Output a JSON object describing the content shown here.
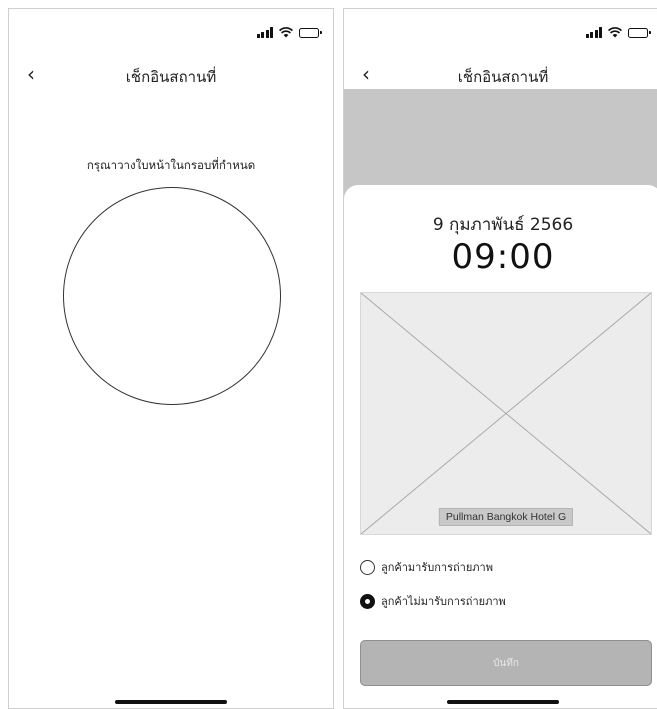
{
  "left_screen": {
    "nav": {
      "back_icon": "‹",
      "title": "เช็กอินสถานที่"
    },
    "instruction": "กรุณาวางใบหน้าในกรอบที่กำหนด"
  },
  "right_screen": {
    "nav": {
      "back_icon": "‹",
      "title": "เช็กอินสถานที่"
    },
    "date": "9 กุมภาพันธ์ 2566",
    "time": "09:00",
    "location_label": "Pullman Bangkok Hotel G",
    "photo_options": [
      {
        "label": "ลูกค้ามารับการถ่ายภาพ",
        "selected": false
      },
      {
        "label": "ลูกค้าไม่มารับการถ่ายภาพ",
        "selected": true
      }
    ],
    "save_label": "บันทึก"
  },
  "status_icons": [
    "signal-icon",
    "wifi-icon",
    "battery-icon"
  ],
  "colors": {
    "camera_backdrop": "#c6c6c6",
    "button_disabled": "#b4b4b4",
    "photo_placeholder": "#ececec"
  }
}
